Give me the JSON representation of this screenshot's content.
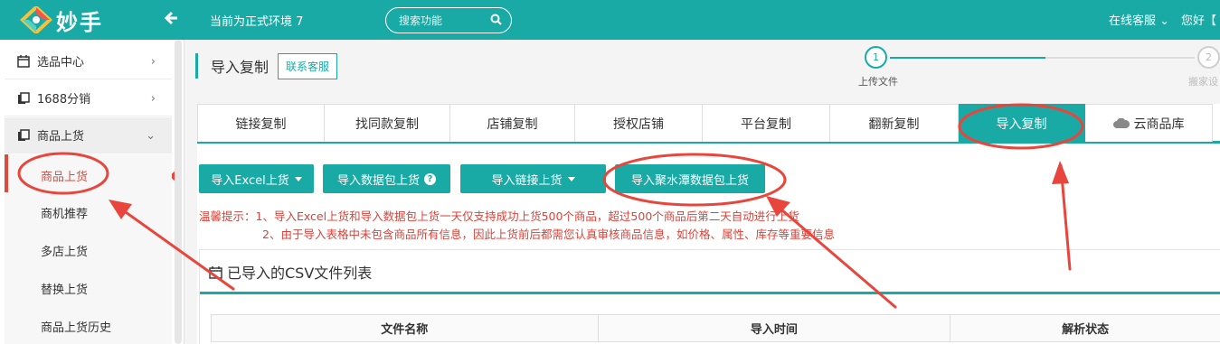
{
  "header": {
    "logo_text": "妙手",
    "env_label": "当前为正式环境 7",
    "search_placeholder": "搜索功能",
    "service_label": "在线客服 ⌄",
    "greeting": "您好【",
    "brand_color": "#1aaaa6"
  },
  "sidebar": {
    "items": [
      {
        "label": "选品中心",
        "icon": "calendar-icon"
      },
      {
        "label": "1688分销",
        "icon": "copy-icon"
      },
      {
        "label": "商品上货",
        "icon": "copy-icon"
      }
    ],
    "sub_items": [
      "商品上货",
      "商机推荐",
      "多店上货",
      "替换上货",
      "商品上货历史"
    ]
  },
  "page": {
    "title": "导入复制",
    "contact_label": "联系客服",
    "steps": [
      {
        "number": "1",
        "label": "上传文件"
      },
      {
        "number": "2",
        "label": "搬家设"
      }
    ]
  },
  "tabs": [
    "链接复制",
    "找同款复制",
    "店铺复制",
    "授权店铺",
    "平台复制",
    "翻新复制",
    "导入复制",
    "云商品库"
  ],
  "active_tab": "导入复制",
  "actions": {
    "import_excel": "导入Excel上货",
    "import_package": "导入数据包上货",
    "import_link": "导入链接上货",
    "import_jushuitan": "导入聚水潭数据包上货"
  },
  "tips": {
    "line1": "温馨提示：1、导入Excel上货和导入数据包上货一天仅支持成功上货500个商品，超过500个商品后第二天自动进行上货",
    "line2": "2、由于导入表格中未包含商品所有信息，因此上货前后都需您认真审核商品信息，如价格、属性、库存等重要信息"
  },
  "csv_section": {
    "title": "已导入的CSV文件列表",
    "columns": [
      "文件名称",
      "导入时间",
      "解析状态"
    ]
  },
  "colors": {
    "accent": "#1aaaa6",
    "warning_text": "#d9433a",
    "annotation": "#e8453c"
  }
}
